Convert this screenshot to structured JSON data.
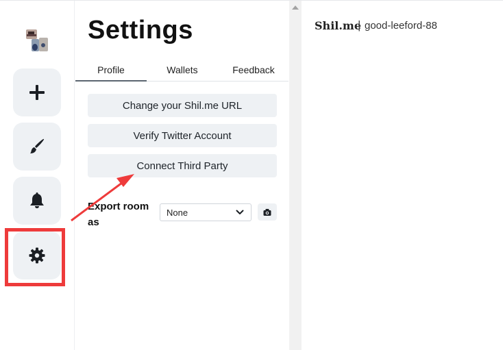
{
  "panel": {
    "title": "Settings",
    "tabs": [
      {
        "label": "Profile",
        "active": true
      },
      {
        "label": "Wallets",
        "active": false
      },
      {
        "label": "Feedback",
        "active": false
      }
    ],
    "actions": [
      {
        "label": "Change your Shil.me URL"
      },
      {
        "label": "Verify Twitter Account"
      },
      {
        "label": "Connect Third Party"
      }
    ],
    "export": {
      "label": "Export room as",
      "selected": "None"
    }
  },
  "rail": {
    "items": [
      {
        "icon": "plus-icon"
      },
      {
        "icon": "paintbrush-icon"
      },
      {
        "icon": "bell-icon"
      },
      {
        "icon": "gear-icon"
      }
    ]
  },
  "header": {
    "brand": "Shil.me",
    "separator": "|",
    "room": "good-leeford-88"
  },
  "annotations": {
    "highlight_color": "#ee3b3b",
    "highlight_target": "gear-icon",
    "arrow_target": "connect-third-party-button"
  },
  "colors": {
    "button_bg": "#eef1f4",
    "annotation_red": "#ee3b3b"
  }
}
